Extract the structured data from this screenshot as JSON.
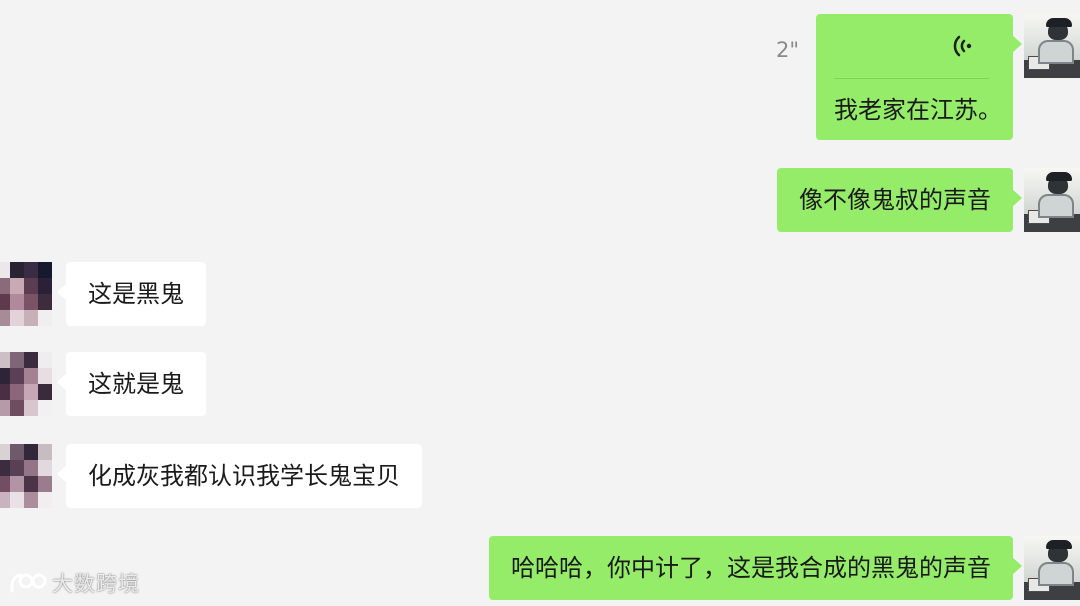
{
  "conversation": {
    "messages": [
      {
        "sender": "self",
        "type": "voice",
        "duration": "2\"",
        "transcript": "我老家在江苏。"
      },
      {
        "sender": "self",
        "type": "text",
        "text": "像不像鬼叔的声音"
      },
      {
        "sender": "other",
        "type": "text",
        "text": "这是黑鬼"
      },
      {
        "sender": "other",
        "type": "text",
        "text": "这就是鬼"
      },
      {
        "sender": "other",
        "type": "text",
        "text": "化成灰我都认识我学长鬼宝贝"
      },
      {
        "sender": "self",
        "type": "text",
        "text": "哈哈哈，你中计了，这是我合成的黑鬼的声音"
      }
    ]
  },
  "watermark": {
    "text": "大数跨境"
  },
  "icons": {
    "voice": "voice-wave-icon",
    "watermark_logo": "brand-logo-icon",
    "avatar_self": "user-photo-avatar",
    "avatar_other": "pixelated-avatar"
  },
  "colors": {
    "background": "#f3f3f3",
    "outgoing_bubble": "#95ec69",
    "incoming_bubble": "#ffffff",
    "text": "#1a1a1a",
    "duration_text": "#8a8a8a"
  }
}
